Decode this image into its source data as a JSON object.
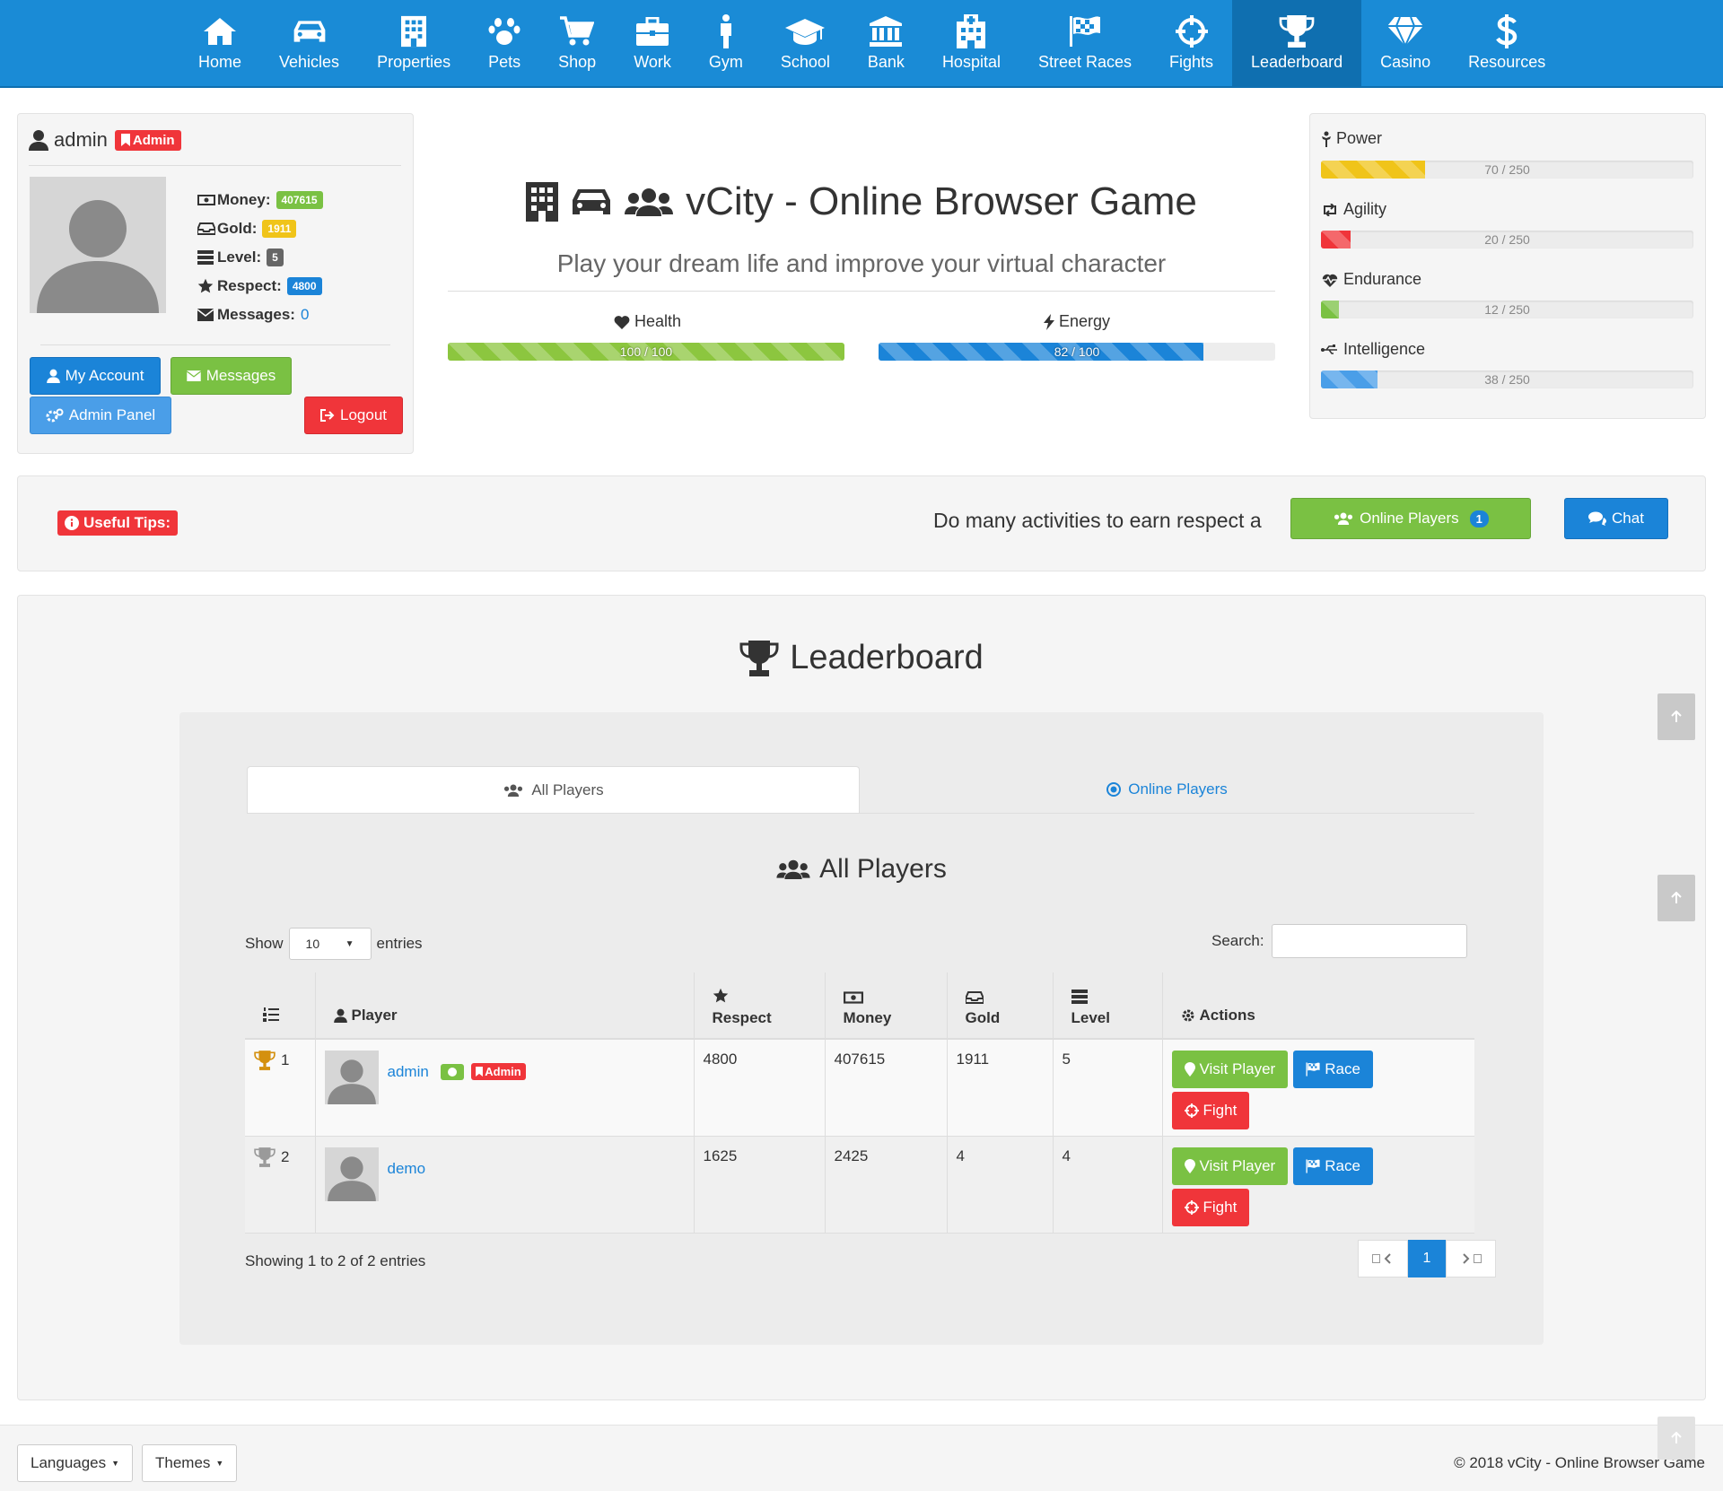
{
  "nav": {
    "items": [
      {
        "label": "Home",
        "icon": "home-icon"
      },
      {
        "label": "Vehicles",
        "icon": "car-icon"
      },
      {
        "label": "Properties",
        "icon": "building-icon"
      },
      {
        "label": "Pets",
        "icon": "paw-icon"
      },
      {
        "label": "Shop",
        "icon": "cart-icon"
      },
      {
        "label": "Work",
        "icon": "briefcase-icon"
      },
      {
        "label": "Gym",
        "icon": "person-icon"
      },
      {
        "label": "School",
        "icon": "graduation-cap-icon"
      },
      {
        "label": "Bank",
        "icon": "bank-icon"
      },
      {
        "label": "Hospital",
        "icon": "hospital-icon"
      },
      {
        "label": "Street Races",
        "icon": "flag-checkered-icon"
      },
      {
        "label": "Fights",
        "icon": "crosshairs-icon"
      },
      {
        "label": "Leaderboard",
        "icon": "trophy-icon"
      },
      {
        "label": "Casino",
        "icon": "diamond-icon"
      },
      {
        "label": "Resources",
        "icon": "dollar-icon"
      }
    ],
    "active": "Leaderboard",
    "color": "#1a8bd6"
  },
  "user": {
    "name": "admin",
    "role_badge": "Admin",
    "money_label": "Money:",
    "money": "407615",
    "gold_label": "Gold:",
    "gold": "1911",
    "level_label": "Level:",
    "level": "5",
    "respect_label": "Respect:",
    "respect": "4800",
    "messages_label": "Messages:",
    "messages": "0",
    "buttons": {
      "my_account": "My Account",
      "messages": "Messages",
      "admin_panel": "Admin Panel",
      "logout": "Logout"
    }
  },
  "header": {
    "title": "vCity - Online Browser Game",
    "subtitle": "Play your dream life and improve your virtual character",
    "health_label": "Health",
    "health_text": "100 / 100",
    "health_value": 100,
    "health_max": 100,
    "energy_label": "Energy",
    "energy_text": "82 / 100",
    "energy_value": 82,
    "energy_max": 100
  },
  "attributes": [
    {
      "name": "Power",
      "text": "70 / 250",
      "value": 70,
      "max": 250,
      "color": "#f0c419",
      "icon": "power-icon"
    },
    {
      "name": "Agility",
      "text": "20 / 250",
      "value": 20,
      "max": 250,
      "color": "#f0353a",
      "icon": "retweet-icon"
    },
    {
      "name": "Endurance",
      "text": "12 / 250",
      "value": 12,
      "max": 250,
      "color": "#7ac143",
      "icon": "heartbeat-icon"
    },
    {
      "name": "Intelligence",
      "text": "38 / 250",
      "value": 38,
      "max": 250,
      "color": "#4a9ee8",
      "icon": "usb-icon"
    }
  ],
  "tips": {
    "label": "Useful Tips:",
    "text": "Do many activities to earn respect a",
    "online_players_button": "Online Players",
    "online_count": "1",
    "chat_button": "Chat"
  },
  "leaderboard": {
    "title": "Leaderboard",
    "tabs": [
      "All Players",
      "Online Players"
    ],
    "active_tab": "All Players",
    "section_title": "All Players",
    "show_label": "Show",
    "entries_label": "entries",
    "page_size": "10",
    "search_label": "Search:",
    "columns": {
      "player": "Player",
      "respect": "Respect",
      "money": "Money",
      "gold": "Gold",
      "level": "Level",
      "actions": "Actions"
    },
    "rows": [
      {
        "rank": "1",
        "name": "admin",
        "online": true,
        "badge": "Admin",
        "respect": "4800",
        "money": "407615",
        "gold": "1911",
        "level": "5",
        "trophy_color": "#d4900e"
      },
      {
        "rank": "2",
        "name": "demo",
        "online": false,
        "badge": "",
        "respect": "1625",
        "money": "2425",
        "gold": "4",
        "level": "4",
        "trophy_color": "#9a9a9a"
      }
    ],
    "actions": {
      "visit": "Visit Player",
      "race": "Race",
      "fight": "Fight"
    },
    "info": "Showing 1 to 2 of 2 entries",
    "current_page": "1"
  },
  "footer": {
    "languages": "Languages",
    "themes": "Themes",
    "copyright": "© 2018 vCity - Online Browser Game"
  }
}
